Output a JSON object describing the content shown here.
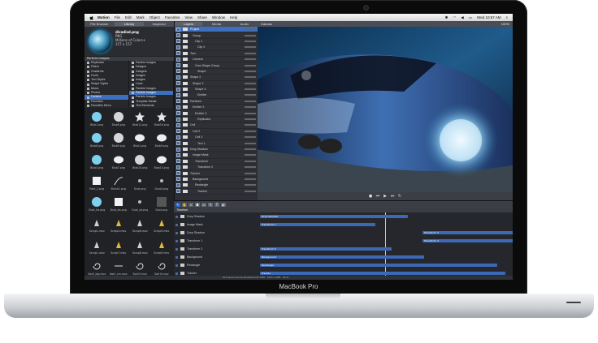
{
  "device": {
    "brand_label": "MacBook Pro"
  },
  "menubar": {
    "app": "Motion",
    "items": [
      "File",
      "Edit",
      "Mark",
      "Object",
      "Favorites",
      "View",
      "Share",
      "Window",
      "Help"
    ],
    "clock": "Wed 10:57 AM"
  },
  "left_panel": {
    "tabs": [
      "File Browser",
      "Library",
      "Inspector"
    ],
    "preview": {
      "title": "dizadisd.png",
      "lines": [
        "PNG",
        "Millions of Colors+",
        "157 x 157"
      ]
    },
    "list_header": "Particle Images",
    "col1": [
      "Replicator",
      "Filters",
      "Gradients",
      "Fonts",
      "Text Styles",
      "Shape Styles",
      "Music",
      "Photos",
      "Content",
      "Favorites",
      "Favorites Menu"
    ],
    "col1_selected": 8,
    "col2": [
      "Particle Images",
      "Designs",
      "Gadgets",
      "Images",
      "Images",
      "Lines",
      "Particle Images",
      "Particle Images",
      "Particle Images",
      "Template Media",
      "Text Elements"
    ],
    "col2_selected": 7,
    "thumbs": [
      {
        "name": "Blob1.png"
      },
      {
        "name": "Blob6.png"
      },
      {
        "name": "Blob12.png"
      },
      {
        "name": "Blob16.png"
      },
      {
        "name": "Blob8.png"
      },
      {
        "name": "Blob9.png"
      },
      {
        "name": "Blob1.png"
      },
      {
        "name": "Blob9.png"
      },
      {
        "name": "Blob4.png"
      },
      {
        "name": "Blob7.png"
      },
      {
        "name": "Blob10.png"
      },
      {
        "name": "Blob14.png"
      },
      {
        "name": "Rect_2.png"
      },
      {
        "name": "Brush1.png"
      },
      {
        "name": "Dust.png"
      },
      {
        "name": "Dust4.png"
      },
      {
        "name": "Dust_hd.png"
      },
      {
        "name": "Dust_ws.png"
      },
      {
        "name": "Dust_sd.png"
      },
      {
        "name": "Dust.png"
      },
      {
        "name": "Scrap1.mov"
      },
      {
        "name": "Scrap4.mov"
      },
      {
        "name": "Scrap6.mov"
      },
      {
        "name": "Scrap9.mov"
      },
      {
        "name": "Scrap1.mov"
      },
      {
        "name": "Scrap7.mov"
      },
      {
        "name": "Scrap8.mov"
      },
      {
        "name": "Scrap9.mov"
      },
      {
        "name": "Swirl_big.mov"
      },
      {
        "name": "Swirl_sm.mov"
      },
      {
        "name": "Swirl3.mov"
      },
      {
        "name": "Swirl4.mov"
      }
    ]
  },
  "layers_panel": {
    "tabs": [
      "Layers",
      "Media",
      "Audio"
    ],
    "rows": [
      "Project",
      "Group",
      "Clip 1",
      "Clip 2",
      "Text",
      "Camera",
      "Cam Shape Group",
      "Shape",
      "Shape 2",
      "Shape 3",
      "Shape 4",
      "Emitter",
      "Particles",
      "Emitter 2",
      "Emitter 3",
      "Replicator",
      "Cell",
      "Cell 2",
      "Cell 3",
      "Text 1",
      "Drop Shadow",
      "Image Mask",
      "Transform",
      "Transform 2",
      "Tracker",
      "Background",
      "Rectangle",
      "Tracker"
    ],
    "selected": 0
  },
  "canvas": {
    "title": "Canvas",
    "zoom": "100%"
  },
  "timeline": {
    "title": "Timeline",
    "rows": [
      "Drop Shadow",
      "Image Mask",
      "Drop Shadow",
      "Transform 1",
      "Transform 2",
      "Background",
      "Rectangle",
      "Tracker"
    ],
    "bars": [
      {
        "label": "Drop Shadow"
      },
      {
        "label": "Transform 1"
      },
      {
        "label": "Transform 3"
      },
      {
        "label": "Transform 4"
      },
      {
        "label": "Transform 5"
      },
      {
        "label": "Background"
      },
      {
        "label": "Rectangle"
      },
      {
        "label": "Tracker"
      }
    ]
  },
  "status": "00 Frames  Avenue Broadcast HD 1080 · 1920 x 1080 · 29.97"
}
